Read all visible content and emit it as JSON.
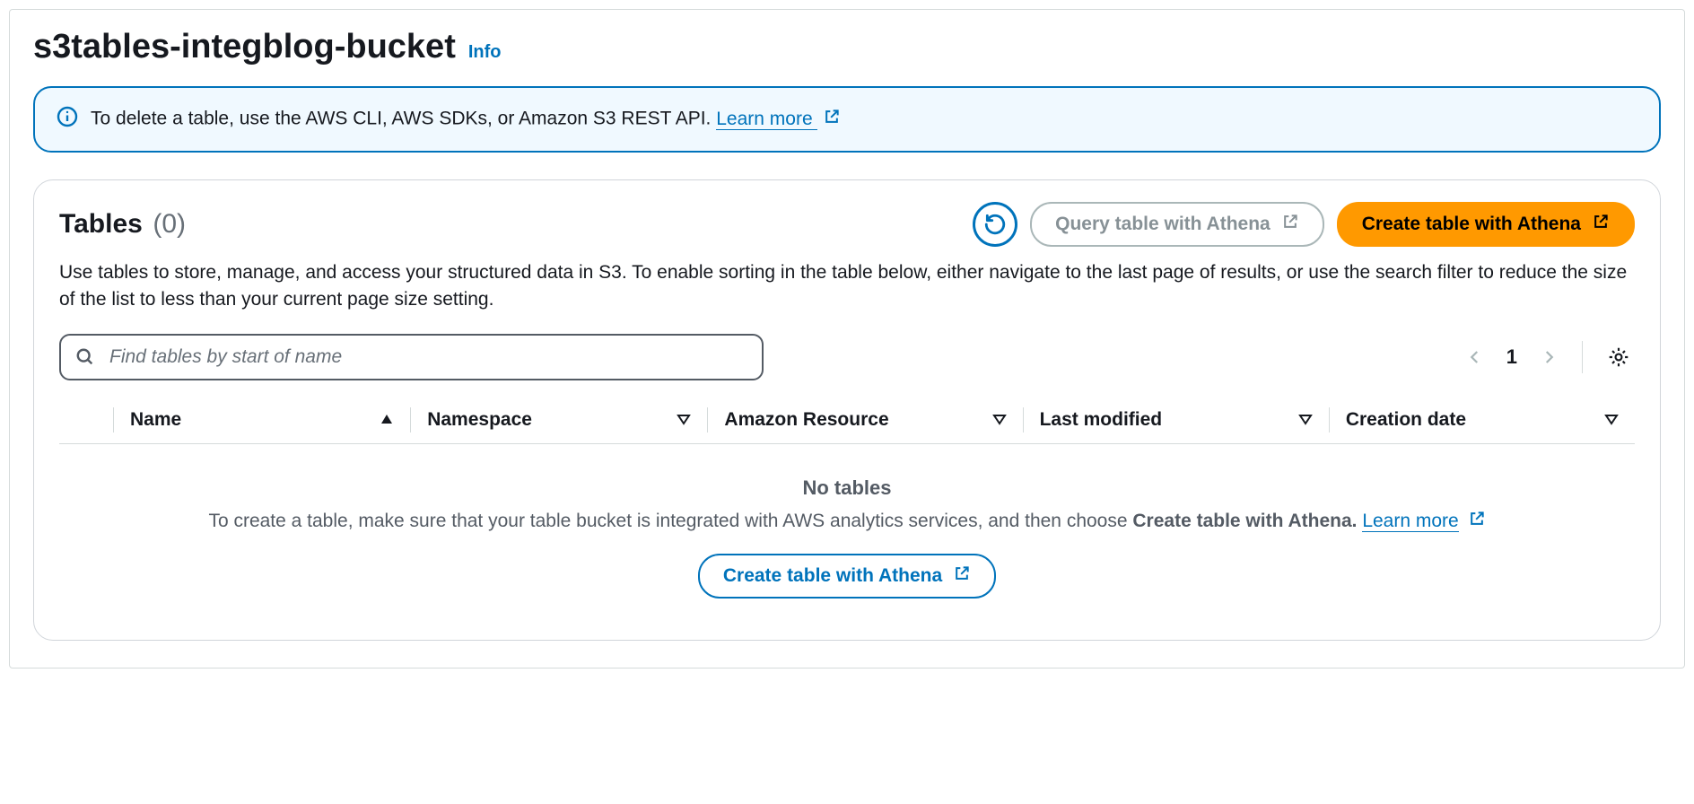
{
  "colors": {
    "accent": "#0073bb",
    "primary": "#ff9900"
  },
  "header": {
    "title": "s3tables-integblog-bucket",
    "info_label": "Info"
  },
  "alert": {
    "text": "To delete a table, use the AWS CLI, AWS SDKs, or Amazon S3 REST API. ",
    "learn_more": "Learn more"
  },
  "panel": {
    "title": "Tables",
    "count_display": "(0)",
    "actions": {
      "query_label": "Query table with Athena",
      "create_label": "Create table with Athena"
    },
    "description": "Use tables to store, manage, and access your structured data in S3. To enable sorting in the table below, either navigate to the last page of results, or use the search filter to reduce the size of the list to less than your current page size setting.",
    "search": {
      "placeholder": "Find tables by start of name"
    },
    "pagination": {
      "page": "1"
    },
    "columns": {
      "name": "Name",
      "namespace": "Namespace",
      "arn": "Amazon Resource",
      "last_modified": "Last modified",
      "creation_date": "Creation date"
    },
    "empty": {
      "title": "No tables",
      "line1": "To create a table, make sure that your table bucket is integrated with AWS analytics services, and then choose ",
      "strong1": "Create table with Athena",
      "tail": ". ",
      "learn_more": "Learn more",
      "button": "Create table with Athena"
    }
  }
}
